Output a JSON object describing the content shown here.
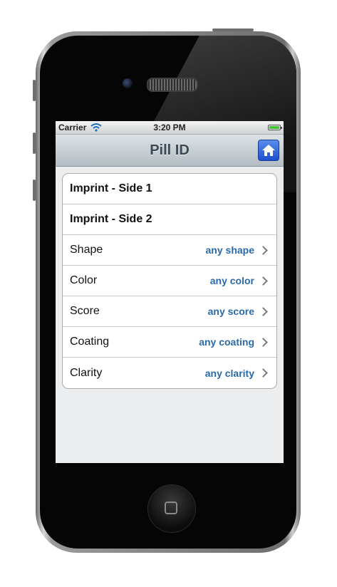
{
  "statusbar": {
    "carrier": "Carrier",
    "time": "3:20 PM",
    "battery_level": 1.0
  },
  "navbar": {
    "title": "Pill ID",
    "home_icon": "home-icon"
  },
  "rows": [
    {
      "label": "Imprint - Side 1",
      "value": ""
    },
    {
      "label": "Imprint - Side 2",
      "value": ""
    },
    {
      "label": "Shape",
      "value": "any shape"
    },
    {
      "label": "Color",
      "value": "any color"
    },
    {
      "label": "Score",
      "value": "any score"
    },
    {
      "label": "Coating",
      "value": "any coating"
    },
    {
      "label": "Clarity",
      "value": "any clarity"
    }
  ],
  "colors": {
    "accent_value": "#2a6aa8",
    "nav_button": "#2f5fdc",
    "background": "#ecedee"
  }
}
